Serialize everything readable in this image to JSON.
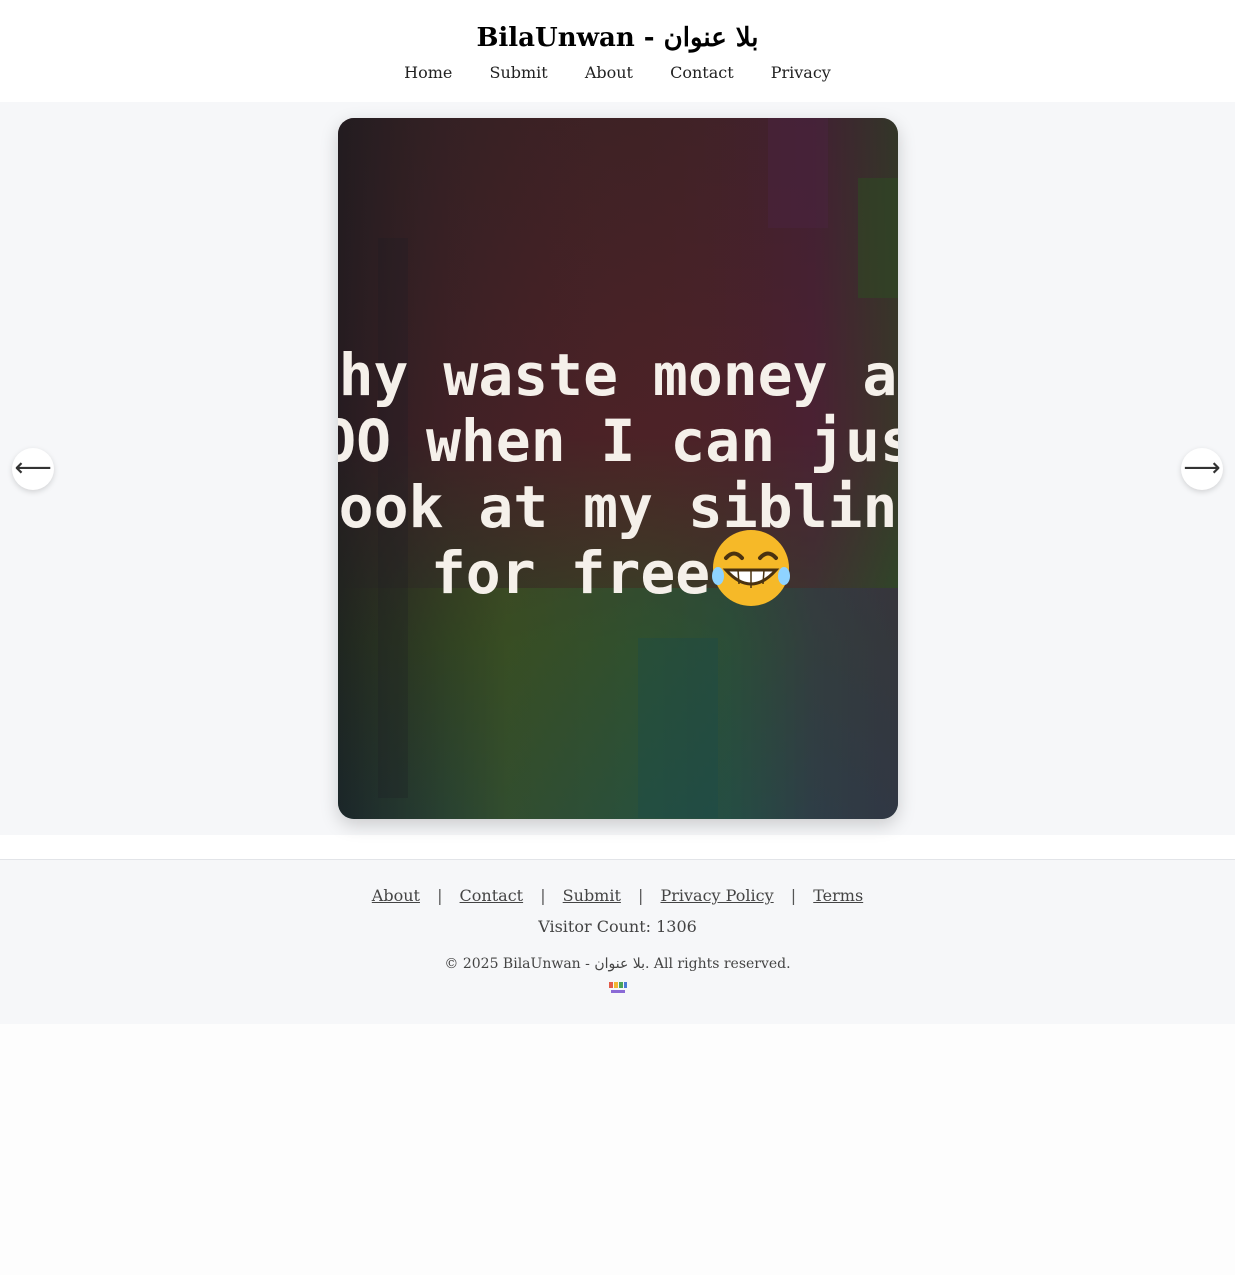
{
  "header": {
    "title": "BilaUnwan - بلا عنوان",
    "nav": [
      "Home",
      "Submit",
      "About",
      "Contact",
      "Privacy"
    ]
  },
  "viewer": {
    "image_text_lines": [
      "hy waste money a",
      "OO when I can jus",
      "look at my sibling",
      "for free."
    ],
    "emoji": "😂",
    "prev_arrow": "⟵",
    "next_arrow": "⟶"
  },
  "footer": {
    "links": [
      "About",
      "Contact",
      "Submit",
      "Privacy Policy",
      "Terms"
    ],
    "separator": "|",
    "visitor_count": "Visitor Count: 1306",
    "copyright": "© 2025 BilaUnwan - بلا عنوان. All rights reserved."
  },
  "colors": {
    "viewer_bg": "#f6f7f9",
    "image_text": "#f5f0ea"
  }
}
